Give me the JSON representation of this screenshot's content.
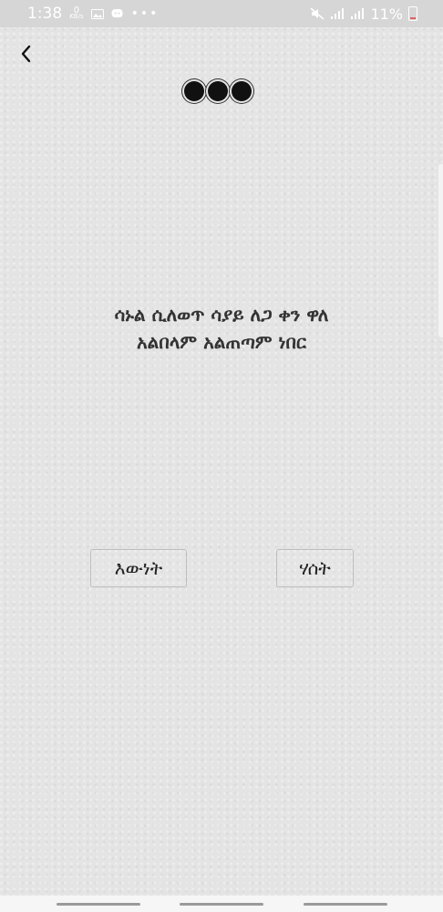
{
  "status_bar": {
    "time": "1:38",
    "net_speed_value": "0",
    "net_speed_unit": "KB/s",
    "more": "•••",
    "battery_percent": "11%"
  },
  "progress": {
    "dots": 3
  },
  "question": {
    "line1": "ሳኑል ሲለወጥ ሳያይ ለጋ ቀን ዋለ",
    "line2": "አልበላም አልጠጣም ነበር"
  },
  "answers": {
    "true_label": "እውነት",
    "false_label": "ሃሰት"
  },
  "icons": {
    "back": "chevron-left-icon",
    "image": "image-icon",
    "message": "message-icon",
    "mute": "mute-icon",
    "signal": "signal-icon"
  }
}
